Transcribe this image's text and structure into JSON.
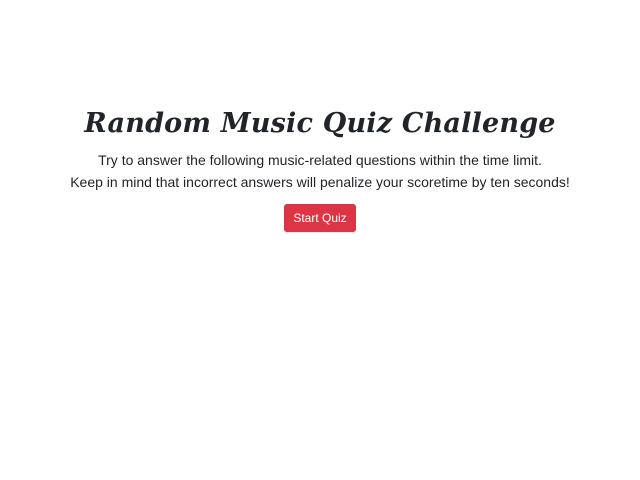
{
  "quiz": {
    "title": "Random Music Quiz Challenge",
    "description_line_1": "Try to answer the following music-related questions within the time limit.",
    "description_line_2": "Keep in mind that incorrect answers will penalize your scoretime by ten seconds!",
    "start_button_label": "Start Quiz"
  },
  "colors": {
    "background": "#ffffff",
    "text": "#212529",
    "accent": "#dc3545",
    "button_text": "#ffffff"
  }
}
